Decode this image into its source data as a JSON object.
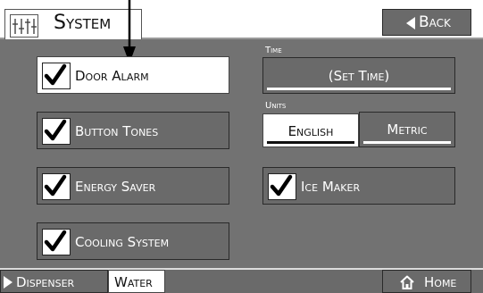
{
  "header": {
    "title": "System",
    "back_label": "Back"
  },
  "toggles": [
    {
      "label": "Door Alarm",
      "checked": true,
      "highlighted": true
    },
    {
      "label": "Button Tones",
      "checked": true,
      "highlighted": false
    },
    {
      "label": "Energy Saver",
      "checked": true,
      "highlighted": false
    },
    {
      "label": "Cooling System",
      "checked": true,
      "highlighted": false
    }
  ],
  "time": {
    "section_label": "Time",
    "button_label": "(Set Time)"
  },
  "units": {
    "section_label": "Units",
    "options": [
      "English",
      "Metric"
    ],
    "selected": "English"
  },
  "ice_maker": {
    "label": "Ice Maker",
    "checked": true
  },
  "footer": {
    "dispenser_label": "Dispenser",
    "water_label": "Water",
    "home_label": "Home"
  },
  "icons": {
    "settings": "sliders-icon",
    "back": "left-triangle-icon",
    "dispenser": "right-triangle-icon",
    "home": "home-icon",
    "check": "checkmark-icon",
    "pointer": "down-arrow-callout"
  }
}
